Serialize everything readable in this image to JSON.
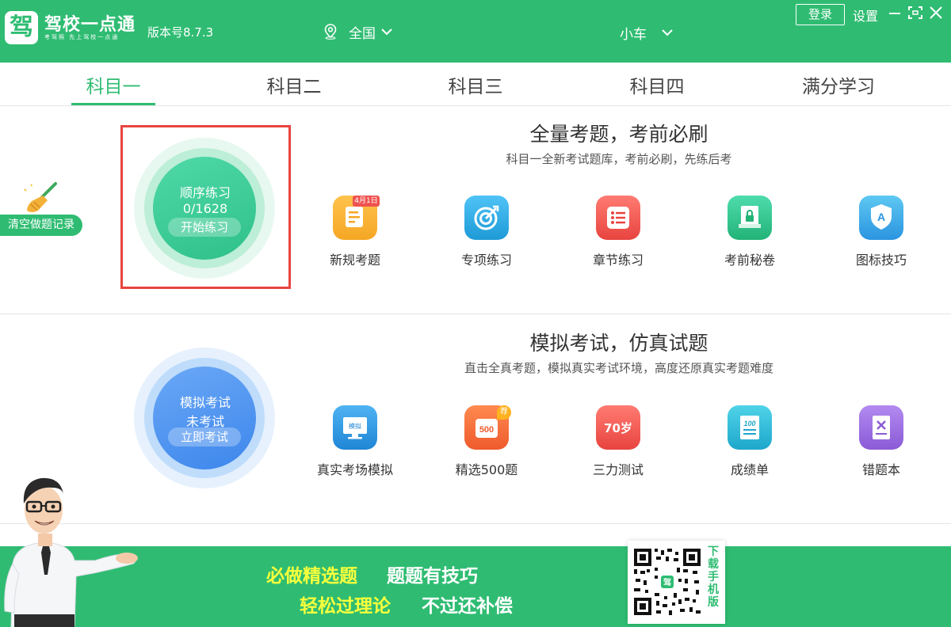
{
  "app": {
    "logo_char": "驾",
    "name": "驾校一点通",
    "slogan": "考驾照 先上驾校一点通",
    "version": "版本号8.7.3"
  },
  "header": {
    "region": "全国",
    "vehicle": "小车",
    "login_label": "登录",
    "settings_label": "设置"
  },
  "tabs": [
    {
      "label": "科目一",
      "active": true
    },
    {
      "label": "科目二",
      "active": false
    },
    {
      "label": "科目三",
      "active": false
    },
    {
      "label": "科目四",
      "active": false
    },
    {
      "label": "满分学习",
      "active": false
    }
  ],
  "clear_records_label": "清空做题记录",
  "practice": {
    "circle_title": "顺序练习",
    "progress": "0/1628",
    "button_label": "开始练习",
    "section_title": "全量考题，考前必刷",
    "section_subtitle": "科目一全新考试题库，考前必刷，先练后考",
    "features": [
      {
        "label": "新规考题",
        "icon": "new-rules-icon",
        "badge": "4月1日",
        "color": "#f5a623"
      },
      {
        "label": "专项练习",
        "icon": "target-icon",
        "color": "#2aa9e0"
      },
      {
        "label": "章节练习",
        "icon": "list-icon",
        "color": "#ef5350"
      },
      {
        "label": "考前秘卷",
        "icon": "secret-paper-icon",
        "color": "#2fc087"
      },
      {
        "label": "图标技巧",
        "icon": "sign-icon",
        "color": "#35a7e8"
      }
    ]
  },
  "exam": {
    "circle_title": "模拟考试",
    "status": "未考试",
    "button_label": "立即考试",
    "section_title": "模拟考试，仿真试题",
    "section_subtitle": "直击全真考题，模拟真实考试环境，高度还原真实考题难度",
    "features": [
      {
        "label": "真实考场模拟",
        "icon": "monitor-icon",
        "screen_text": "模拟",
        "color": "#2d9ae0"
      },
      {
        "label": "精选500题",
        "icon": "500-icon",
        "icon_text": "500",
        "badge": "荐",
        "color": "#f26b3a"
      },
      {
        "label": "三力测试",
        "icon": "70-age-icon",
        "icon_text": "70岁",
        "color": "#ef5350"
      },
      {
        "label": "成绩单",
        "icon": "score-icon",
        "icon_text": "100",
        "color": "#2fb4d4"
      },
      {
        "label": "错题本",
        "icon": "wrong-book-icon",
        "color": "#9b6ddb"
      }
    ]
  },
  "banner": {
    "line1a": "必做精选题",
    "line1b": "题题有技巧",
    "line2a": "轻松过理论",
    "line2b": "不过还补偿",
    "qr_label": "下载手机版",
    "qr_center": "驾",
    "highlight_color": "#f7ff3c"
  }
}
